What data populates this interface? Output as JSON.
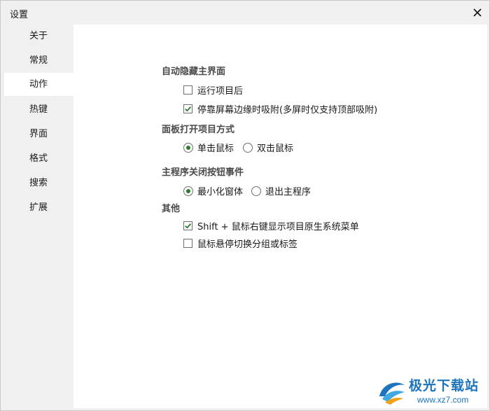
{
  "window": {
    "title": "设置"
  },
  "sidebar": {
    "items": [
      {
        "label": "关于",
        "active": false
      },
      {
        "label": "常规",
        "active": false
      },
      {
        "label": "动作",
        "active": true
      },
      {
        "label": "热键",
        "active": false
      },
      {
        "label": "界面",
        "active": false
      },
      {
        "label": "格式",
        "active": false
      },
      {
        "label": "搜索",
        "active": false
      },
      {
        "label": "扩展",
        "active": false
      }
    ]
  },
  "sections": {
    "auto_hide": {
      "title": "自动隐藏主界面",
      "run_item_after": {
        "label": "运行项目后",
        "checked": false
      },
      "dock_edge": {
        "label": "停靠屏幕边缘时吸附(多屏时仅支持顶部吸附)",
        "checked": true
      }
    },
    "panel_open": {
      "title": "面板打开项目方式",
      "single_click": {
        "label": "单击鼠标",
        "selected": true
      },
      "double_click": {
        "label": "双击鼠标",
        "selected": false
      }
    },
    "close_button": {
      "title": "主程序关闭按钮事件",
      "minimize": {
        "label": "最小化窗体",
        "selected": true
      },
      "exit": {
        "label": "退出主程序",
        "selected": false
      }
    },
    "other": {
      "title": "其他",
      "shift_right_click": {
        "label": "Shift + 鼠标右键显示项目原生系统菜单",
        "checked": true
      },
      "hover_switch": {
        "label": "鼠标悬停切换分组或标签",
        "checked": false
      }
    }
  },
  "watermark": {
    "name": "极光下载站",
    "url": "www.xz7.com"
  },
  "colors": {
    "active_item_bg": "#ffffff",
    "sidebar_bg": "#f0f0f0",
    "radio_dot": "#2a7d2a",
    "check_mark": "#2a7d2a",
    "watermark_blue": "#1c74bd"
  }
}
